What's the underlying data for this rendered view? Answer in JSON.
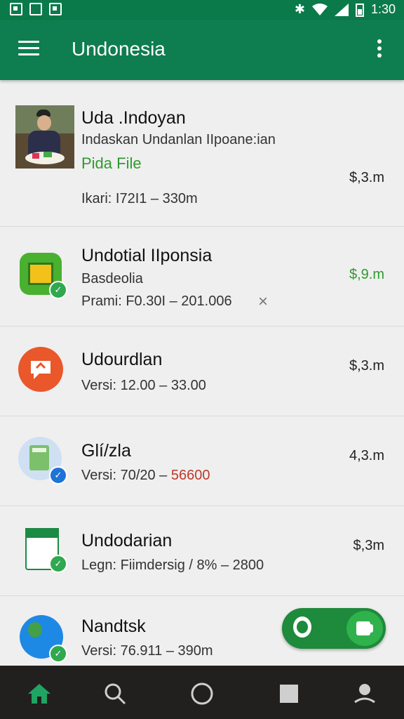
{
  "status": {
    "time": "1:30"
  },
  "app": {
    "title": "Undonesia"
  },
  "items": [
    {
      "name": "Uda .Indoyan",
      "subtitle": "Indaskan Undanlan IIpoane:ian",
      "link": "Pida File",
      "meta": "Ikari: I72I1  – 330m",
      "price": "$,3.m"
    },
    {
      "name": "Undotial IIponsia",
      "subtitle": "Basdeolia",
      "meta": "Prami: F0.30I – 201.006",
      "price": "$,9.m",
      "dismiss": "×"
    },
    {
      "name": "Udourdlan",
      "meta": "Versi: 12.00 – 33.00",
      "price": "$,3.m"
    },
    {
      "name": "Glí/zla",
      "meta_prefix": "Versi: 70/20 – ",
      "meta_highlight": "56600",
      "price": "4,3.m"
    },
    {
      "name": "Undodarian",
      "meta": "Legn: Fiimdersig / 8% – 2800",
      "price": "$,3m"
    },
    {
      "name": "Nandtsk",
      "meta": "Versi: 76.911 – 390m"
    }
  ],
  "colors": {
    "primary": "#0e7d4f",
    "accent_green": "#2e9a2e",
    "highlight_red": "#c0392b"
  },
  "nav": [
    "home-icon",
    "search-icon",
    "circle-icon",
    "square-icon",
    "person-icon"
  ]
}
